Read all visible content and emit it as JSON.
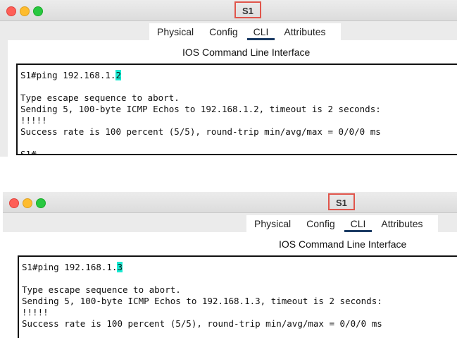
{
  "windows": [
    {
      "title": "S1",
      "tabs": [
        "Physical",
        "Config",
        "CLI",
        "Attributes"
      ],
      "active_tab": "CLI",
      "panel_title": "IOS Command Line Interface",
      "cli": {
        "prompt_cmd": "S1#ping 192.168.1.",
        "highlight": "2",
        "lines": [
          "",
          "Type escape sequence to abort.",
          "Sending 5, 100-byte ICMP Echos to 192.168.1.2, timeout is 2 seconds:",
          "!!!!!",
          "Success rate is 100 percent (5/5), round-trip min/avg/max = 0/0/0 ms",
          "",
          "S1#"
        ]
      }
    },
    {
      "title": "S1",
      "tabs": [
        "Physical",
        "Config",
        "CLI",
        "Attributes"
      ],
      "active_tab": "CLI",
      "panel_title": "IOS Command Line Interface",
      "cli": {
        "prompt_cmd": "S1#ping 192.168.1.",
        "highlight": "3",
        "lines": [
          "",
          "Type escape sequence to abort.",
          "Sending 5, 100-byte ICMP Echos to 192.168.1.3, timeout is 2 seconds:",
          "!!!!!",
          "Success rate is 100 percent (5/5), round-trip min/avg/max = 0/0/0 ms"
        ]
      }
    }
  ],
  "colors": {
    "highlight": "#19ead2",
    "title_outline": "#e0554b",
    "active_tab_underline": "#1a3a63"
  }
}
